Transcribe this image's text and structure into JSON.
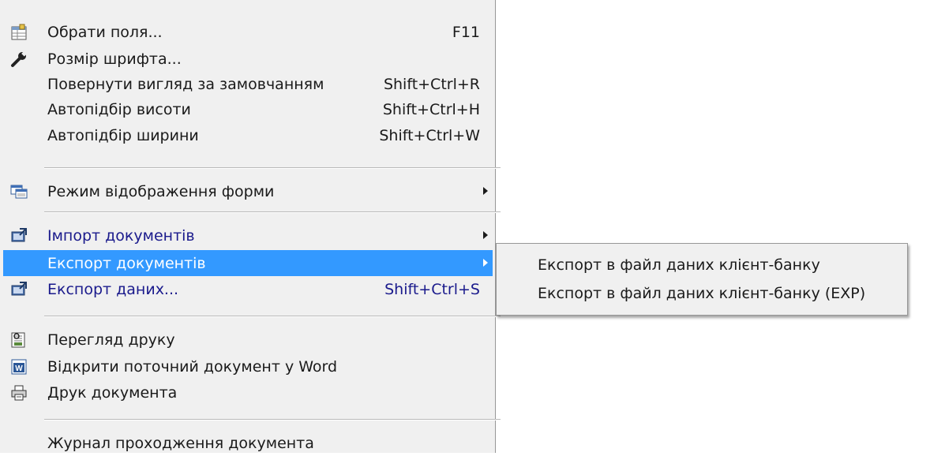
{
  "menu": {
    "items": [
      {
        "label": "Обрати поля...",
        "shortcut": "F11",
        "icon": "table-icon"
      },
      {
        "label": "Розмір шрифта...",
        "shortcut": "",
        "icon": "wrench-icon"
      },
      {
        "label": "Повернути вигляд за замовчанням",
        "shortcut": "Shift+Ctrl+R"
      },
      {
        "label": "Автопідбір висоти",
        "shortcut": "Shift+Ctrl+H"
      },
      {
        "label": "Автопідбір ширини",
        "shortcut": "Shift+Ctrl+W"
      },
      {
        "label": "Режим відображення форми",
        "icon": "form-view-icon",
        "submenu": true
      },
      {
        "label": "Імпорт документів",
        "icon": "import-icon",
        "submenu": true
      },
      {
        "label": "Експорт документів",
        "submenu": true,
        "selected": true
      },
      {
        "label": "Експорт даних...",
        "shortcut": "Shift+Ctrl+S",
        "icon": "export-data-icon"
      },
      {
        "label": "Перегляд друку",
        "icon": "print-preview-icon"
      },
      {
        "label": "Відкрити поточний документ у Word",
        "icon": "word-icon"
      },
      {
        "label": "Друк документа",
        "icon": "printer-icon"
      },
      {
        "label": "Журнал проходження документа"
      }
    ]
  },
  "submenu": {
    "items": [
      {
        "label": "Експорт в файл даних клієнт-банку"
      },
      {
        "label": "Експорт в файл даних клієнт-банку (EXP)"
      }
    ]
  },
  "colors": {
    "menu_bg": "#f0f0f0",
    "selection": "#3399ff",
    "link_text": "#1a1a8c"
  }
}
